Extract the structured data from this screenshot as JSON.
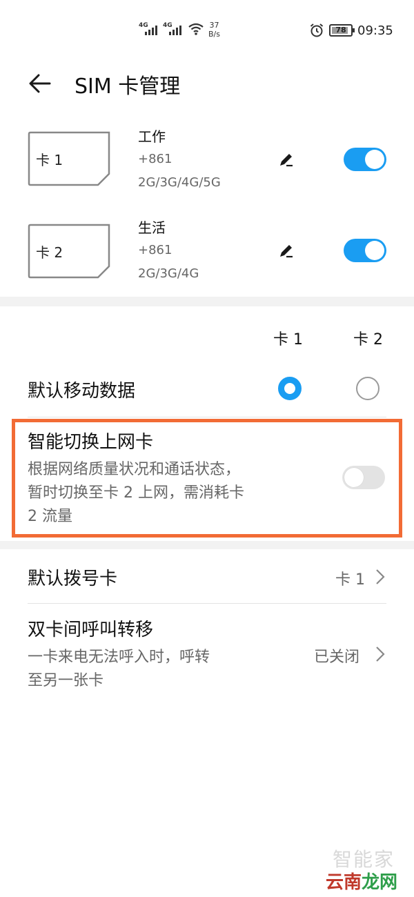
{
  "status_bar": {
    "sim1_network": "4G",
    "sim2_network": "4G",
    "speed_value": "37",
    "speed_unit": "B/s",
    "battery": "78",
    "time": "09:35",
    "icons": [
      "signal-icon",
      "wifi-icon",
      "alarm-icon",
      "battery-icon"
    ]
  },
  "header": {
    "title": "SIM 卡管理",
    "back_icon": "back-arrow-icon"
  },
  "sims": [
    {
      "card_label": "卡 1",
      "name": "工作",
      "number": "+861",
      "networks": "2G/3G/4G/5G",
      "enabled": true
    },
    {
      "card_label": "卡 2",
      "name": "生活",
      "number": "+861",
      "networks": "2G/3G/4G",
      "enabled": true
    }
  ],
  "columns": {
    "card1": "卡 1",
    "card2": "卡 2"
  },
  "default_data": {
    "label": "默认移动数据",
    "selected": "card1"
  },
  "smart_switch": {
    "title": "智能切换上网卡",
    "desc_line1": "根据网络质量状况和通话状态，",
    "desc_line2": "暂时切换至卡 2 上网，需消耗卡",
    "desc_line3": "2 流量",
    "enabled": false,
    "highlight_color": "#f26b35"
  },
  "default_dial": {
    "label": "默认拨号卡",
    "value": "卡 1"
  },
  "call_forward": {
    "label": "双卡间呼叫转移",
    "desc_line1": "一卡来电无法呼入时，呼转",
    "desc_line2": "至另一张卡",
    "value": "已关闭"
  },
  "watermark": {
    "top": "智能家",
    "bottom_part1": "云南",
    "bottom_part2": "龙网"
  },
  "colors": {
    "accent": "#1a9df2",
    "toggle_off": "#e3e3e3",
    "section_gap": "#f2f2f2"
  }
}
